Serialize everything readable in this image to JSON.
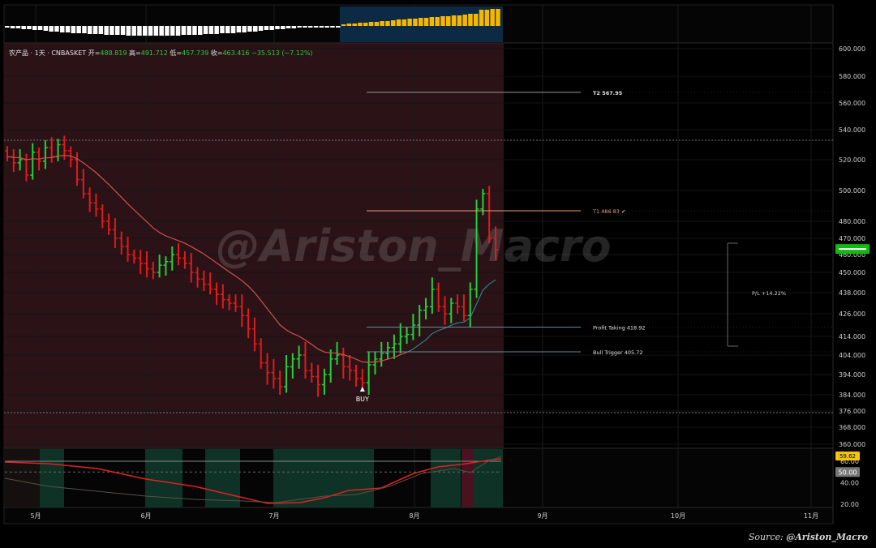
{
  "header": {
    "symbol": "农产品 · 1天 · CNBASKET",
    "open_label": "开=",
    "open_value": "488.819",
    "high_label": "高=",
    "high_value": "491.712",
    "low_label": "低=",
    "low_value": "457.739",
    "close_label": "收=",
    "close_value": "463.416",
    "change_value": "−35.513 (−7.12%)"
  },
  "watermark": "@Ariston_Macro",
  "source_label": "Source:",
  "source_value": "@Ariston_Macro",
  "colors": {
    "up": "#22d13a",
    "down": "#e01b1b",
    "ma": "#d05050",
    "ma_recent": "#2f7f8f",
    "histogram_pos": "#f5b800",
    "histogram_neg": "#ffffff",
    "bg_dark_red": "#2a1216",
    "level_line": "#9a9a9a",
    "t1": "#e8a070",
    "price_tag": "#14b814",
    "rsi_tag_top": "#f1c40f"
  },
  "chart_data": {
    "type": "candlestick",
    "y_axis_ticks": [
      "600.000",
      "580.000",
      "560.000",
      "540.000",
      "520.000",
      "500.000",
      "480.000",
      "470.000",
      "460.000",
      "450.000",
      "438.000",
      "426.000",
      "414.000",
      "404.000",
      "394.000",
      "384.000",
      "376.000",
      "368.000",
      "360.000"
    ],
    "x_axis_labels": [
      "5月",
      "6月",
      "7月",
      "8月",
      "9月",
      "10月",
      "11月"
    ],
    "ohlc_close_series": [
      522,
      518,
      520,
      510,
      525,
      519,
      528,
      522,
      530,
      526,
      520,
      507,
      498,
      492,
      488,
      480,
      475,
      470,
      465,
      460,
      458,
      455,
      452,
      450,
      454,
      456,
      460,
      458,
      455,
      450,
      446,
      443,
      440,
      437,
      434,
      432,
      430,
      425,
      418,
      410,
      400,
      395,
      392,
      388,
      398,
      402,
      404,
      396,
      393,
      389,
      394,
      402,
      404,
      398,
      396,
      392,
      390,
      399,
      402,
      405,
      408,
      410,
      414,
      415,
      420,
      428,
      430,
      440,
      430,
      426,
      432,
      430,
      425,
      440,
      488,
      498,
      470,
      463
    ],
    "moving_average": "descending from ~528 to ~404 by late July, then rising to ~448",
    "levels": [
      {
        "label": "T2 567.95",
        "value": 567.95
      },
      {
        "label": "T1 486.83",
        "value": 486.83
      },
      {
        "label": "Profit Taking 418.92",
        "value": 418.92
      },
      {
        "label": "Bull Trigger 405.72",
        "value": 405.72
      }
    ],
    "annotations": {
      "buy_label": "BUY",
      "pl_label": "P/L +14.22%"
    },
    "last_price": "463.416",
    "rsi_panel": {
      "ticks": [
        "60.00",
        "50.00",
        "40.00",
        "20.00"
      ],
      "current_value": "59.62",
      "midline_value": "50.00"
    }
  }
}
